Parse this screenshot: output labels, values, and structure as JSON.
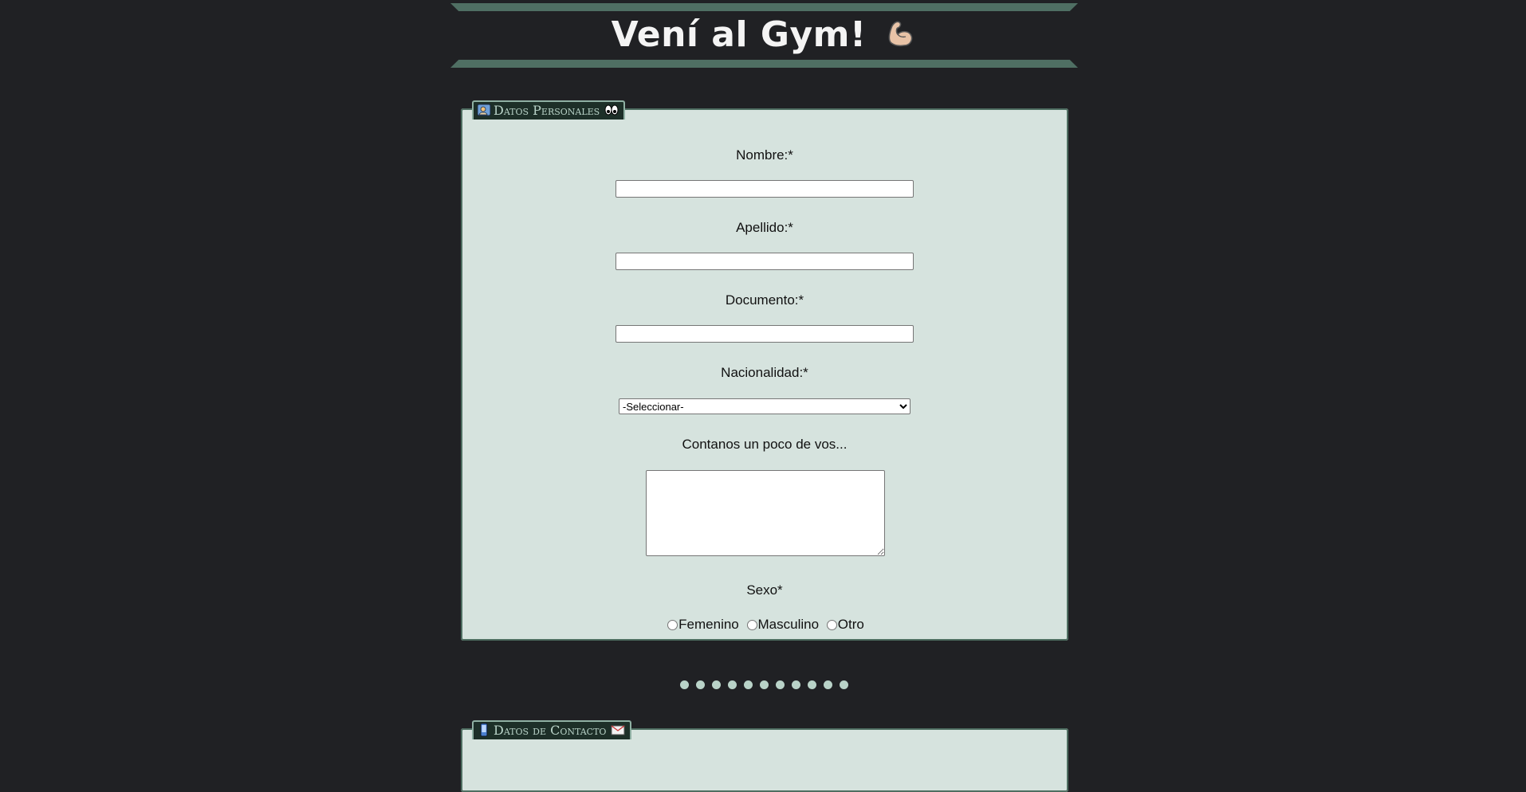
{
  "header": {
    "title": "Vení al Gym!",
    "emoji": "flexed-biceps-icon",
    "bar_color": "#4f6f63"
  },
  "personal_section": {
    "legend": "Datos Personales",
    "left_icon": "person-id-icon",
    "right_icon": "eyes-icon",
    "fields": {
      "nombre_label": "Nombre:*",
      "nombre_value": "",
      "apellido_label": "Apellido:*",
      "apellido_value": "",
      "documento_label": "Documento:*",
      "documento_value": "",
      "nacionalidad_label": "Nacionalidad:*",
      "nacionalidad_selected": "-Seleccionar-",
      "about_label": "Contanos un poco de vos...",
      "about_value": "",
      "sexo_label": "Sexo*",
      "sexo_options": [
        "Femenino",
        "Masculino",
        "Otro"
      ]
    }
  },
  "progress_dots": {
    "count": 11,
    "color": "#b9d3c8"
  },
  "contact_section": {
    "legend": "Datos de Contacto",
    "left_icon": "phone-icon",
    "right_icon": "mail-icon"
  },
  "colors": {
    "background": "#202124",
    "panel": "#d6e3de",
    "panel_border": "#4e6e61",
    "legend_bg": "#1d2f28",
    "legend_text": "#b9d3c8"
  }
}
